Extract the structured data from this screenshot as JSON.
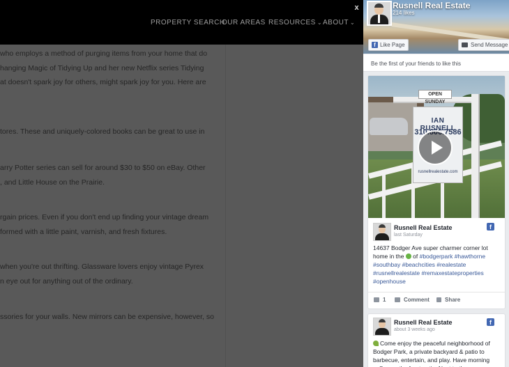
{
  "nav": {
    "items": [
      {
        "label": "PROPERTY SEARCH",
        "dropdown": false
      },
      {
        "label": "OUR AREAS",
        "dropdown": false
      },
      {
        "label": "RESOURCES",
        "dropdown": true
      },
      {
        "label": "ABOUT",
        "dropdown": true
      }
    ],
    "caret": "⌄"
  },
  "article": {
    "paragraphs": [
      [
        "who employs a method of purging items from your home that do",
        "hanging Magic of Tidying Up and her new Netflix series Tidying",
        "at doesn't spark joy for others, might spark joy for you. Here are"
      ],
      [
        "tores. These and uniquely-colored books can be great to use in"
      ],
      [
        "arry Potter series can sell for around $30 to $50 on eBay. Other",
        ", and Little House on the Prairie."
      ],
      [
        "rgain prices. Even if you don't end up finding your vintage dream",
        "formed with a little paint, varnish, and fresh fixtures."
      ],
      [
        "when you're out thrifting. Glassware lovers enjoy vintage Pyrex",
        "n eye out for anything out of the ordinary."
      ],
      [
        "ssories for your walls. New mirrors can be expensive, however, so"
      ]
    ]
  },
  "popup": {
    "close_label": "x"
  },
  "fb": {
    "page_name": "Rusnell Real Estate",
    "likes": "214 likes",
    "like_button": "Like Page",
    "message_button": "Send Message",
    "friends_text": "Be the first of your friends to like this",
    "video": {
      "sign_top": "OPEN SUNDAY",
      "sign_name": "IAN RUSNELL",
      "sign_phone": "310.806.7586",
      "sign_line": "rusnellrealestate.com"
    },
    "posts": [
      {
        "author": "Rusnell Real Estate",
        "time": "last Saturday",
        "text_parts": [
          "14637 Bodger Ave super charmer corner lot home in the ",
          "heart",
          " of ",
          "#bodgerpark",
          " ",
          "#hawthorne",
          " ",
          "#southbay",
          " ",
          "#beachcities",
          " ",
          "#realestate",
          " ",
          "#rusnellrealestate",
          " ",
          "#remaxestateproperties",
          " ",
          "#openhouse"
        ],
        "likes_count": "1",
        "comment_label": "Comment",
        "share_label": "Share"
      },
      {
        "author": "Rusnell Real Estate",
        "time": "about 3 weeks ago",
        "text": "Come enjoy the peaceful neighborhood of Bodger Park, a private backyard & patio to barbecue, entertain, and play. Have morning coffee on the front patio. Next to the"
      }
    ],
    "colors": {
      "brand": "#4267b2",
      "link": "#385898",
      "background": "#e9ebee"
    }
  }
}
